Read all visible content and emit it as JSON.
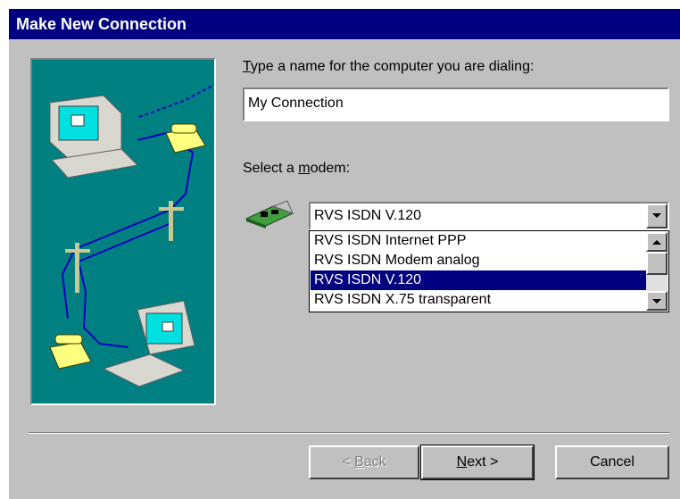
{
  "window": {
    "title": "Make New Connection"
  },
  "name_field": {
    "label_prefix": "",
    "label_underlined": "T",
    "label_rest": "ype a name for the computer you are dialing:",
    "value": "My Connection"
  },
  "modem": {
    "label_prefix": "Select a ",
    "label_underlined": "m",
    "label_rest": "odem:",
    "selected": "RVS ISDN V.120",
    "options": [
      "RVS ISDN Internet PPP",
      "RVS ISDN Modem analog",
      "RVS ISDN V.120",
      "RVS ISDN X.75 transparent"
    ],
    "highlighted_index": 2
  },
  "buttons": {
    "back_prefix": "< ",
    "back_underlined": "B",
    "back_rest": "ack",
    "next_underlined": "N",
    "next_rest": "ext >",
    "cancel": "Cancel"
  },
  "colors": {
    "titlebar": "#000080",
    "dialog": "#c0c0c0",
    "illustration_bg": "#008080",
    "selection": "#000080"
  },
  "icons": {
    "illustration": "dial-up-illustration",
    "modem": "modem-card-icon",
    "combo_arrow": "chevron-down-icon",
    "scroll_up": "arrow-up-icon",
    "scroll_down": "arrow-down-icon"
  }
}
